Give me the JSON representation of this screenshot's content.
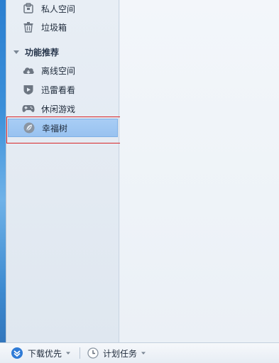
{
  "sidebar": {
    "items_top": [
      {
        "label": "私人空间",
        "icon": "lock-icon"
      },
      {
        "label": "垃圾箱",
        "icon": "trash-icon"
      }
    ],
    "section": {
      "label": "功能推荐",
      "icon": "triangle-down-icon"
    },
    "items_feature": [
      {
        "label": "离线空间",
        "icon": "cloud-icon"
      },
      {
        "label": "迅雷看看",
        "icon": "video-icon"
      },
      {
        "label": "休闲游戏",
        "icon": "gamepad-icon"
      },
      {
        "label": "幸福树",
        "icon": "leaf-icon"
      }
    ],
    "selected": "幸福树"
  },
  "statusbar": {
    "download_priority": "下载优先",
    "scheduled_task": "计划任务"
  },
  "colors": {
    "selection_bg": "#a8cdf5",
    "highlight_box": "#d8262a",
    "icon_gray": "#6d7682",
    "accent_blue": "#2f7bd6"
  }
}
